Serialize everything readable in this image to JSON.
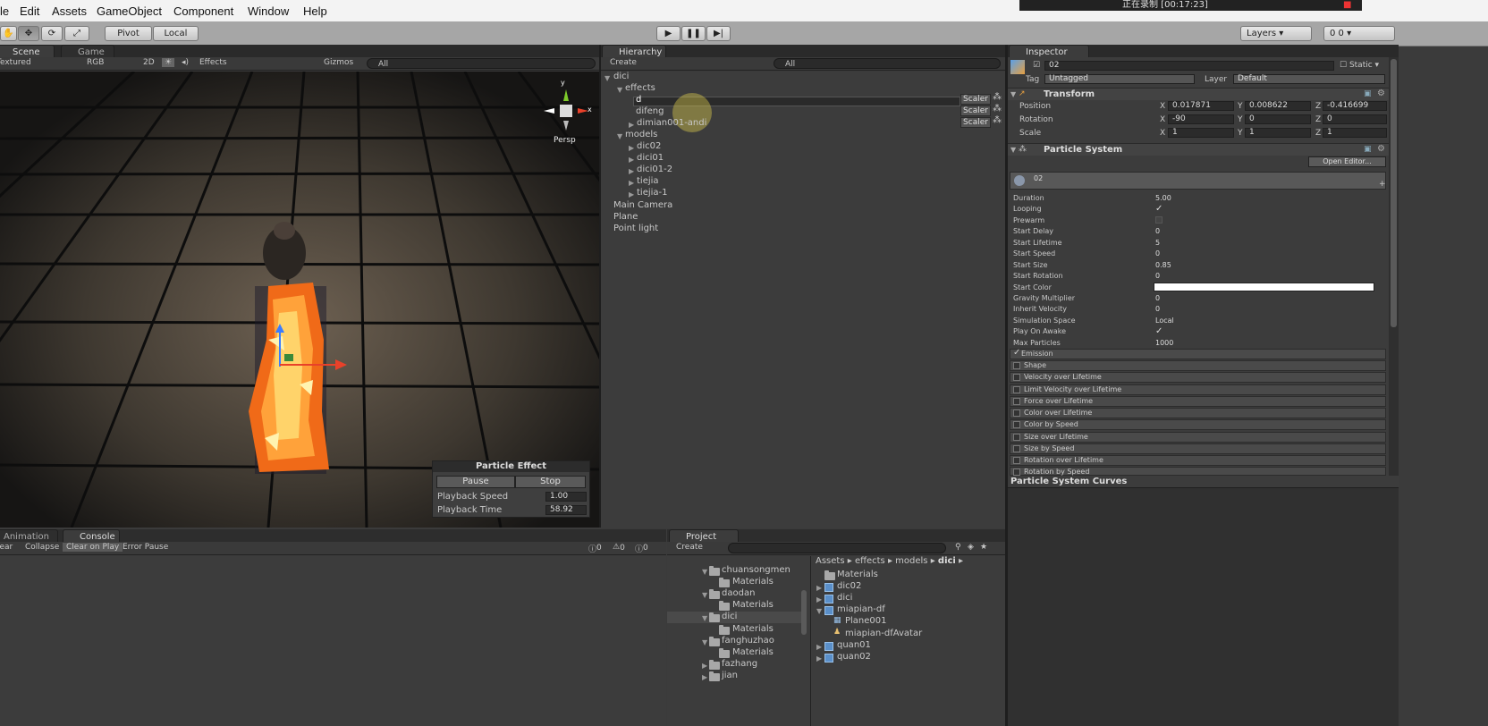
{
  "menu": [
    "le",
    "Edit",
    "Assets",
    "GameObject",
    "Component",
    "Window",
    "Help"
  ],
  "recorder": {
    "status": "正在录制 [00:17:23]"
  },
  "toolbar": {
    "pivot": "Pivot",
    "local": "Local",
    "layers": "Layers",
    "layout": "0 0"
  },
  "scene_view": {
    "tabs": [
      "Scene",
      "Game"
    ],
    "options": [
      "Textured",
      "RGB",
      "2D",
      "Effects",
      "Gizmos"
    ],
    "search_placeholder": "All",
    "gizmo": {
      "y": "y",
      "x": "x",
      "persp": "Persp"
    }
  },
  "particle_effect": {
    "title": "Particle Effect",
    "pause": "Pause",
    "stop": "Stop",
    "playback_speed_label": "Playback Speed",
    "playback_speed": "1.00",
    "playback_time_label": "Playback Time",
    "playback_time": "58.92"
  },
  "hierarchy": {
    "tab": "Hierarchy",
    "create": "Create",
    "search_placeholder": "All",
    "items": [
      "dici",
      "effects",
      "d",
      "difeng",
      "dimian001-andi",
      "models",
      "dic02",
      "dici01",
      "dici01-2",
      "tiejia",
      "tiejia-1",
      "Main Camera",
      "Plane",
      "Point light"
    ],
    "scaler": "Scaler"
  },
  "inspector": {
    "tab": "Inspector",
    "object_name": "02",
    "static": "Static",
    "tag_label": "Tag",
    "tag": "Untagged",
    "layer_label": "Layer",
    "layer": "Default",
    "transform": {
      "title": "Transform",
      "position_label": "Position",
      "position": {
        "x": "0.017871",
        "y": "0.008622",
        "z": "-0.416699"
      },
      "rotation_label": "Rotation",
      "rotation": {
        "x": "-90",
        "y": "0",
        "z": "0"
      },
      "scale_label": "Scale",
      "scale": {
        "x": "1",
        "y": "1",
        "z": "1"
      }
    },
    "particle_system": {
      "title": "Particle System",
      "open_editor": "Open Editor...",
      "system_name": "02",
      "properties": [
        {
          "label": "Duration",
          "value": "5.00"
        },
        {
          "label": "Looping",
          "value": "✓"
        },
        {
          "label": "Prewarm",
          "value": ""
        },
        {
          "label": "Start Delay",
          "value": "0"
        },
        {
          "label": "Start Lifetime",
          "value": "5"
        },
        {
          "label": "Start Speed",
          "value": "0"
        },
        {
          "label": "Start Size",
          "value": "0.85"
        },
        {
          "label": "Start Rotation",
          "value": "0"
        },
        {
          "label": "Start Color",
          "value": ""
        },
        {
          "label": "Gravity Multiplier",
          "value": "0"
        },
        {
          "label": "Inherit Velocity",
          "value": "0"
        },
        {
          "label": "Simulation Space",
          "value": "Local"
        },
        {
          "label": "Play On Awake",
          "value": "✓"
        },
        {
          "label": "Max Particles",
          "value": "1000"
        }
      ],
      "modules": [
        "Emission",
        "Shape",
        "Velocity over Lifetime",
        "Limit Velocity over Lifetime",
        "Force over Lifetime",
        "Color over Lifetime",
        "Color by Speed",
        "Size over Lifetime",
        "Size by Speed",
        "Rotation over Lifetime",
        "Rotation by Speed"
      ],
      "emission_enabled": true
    },
    "curves_title": "Particle System Curves"
  },
  "console": {
    "tabs": [
      "Animation",
      "Console"
    ],
    "buttons": [
      "lear",
      "Collapse",
      "Clear on Play",
      "Error Pause"
    ],
    "counts": [
      "0",
      "0",
      "0"
    ]
  },
  "project": {
    "tab": "Project",
    "create": "Create",
    "breadcrumb": [
      "Assets",
      "effects",
      "models",
      "dici"
    ],
    "folders": [
      "chuansongmen",
      "Materials",
      "daodan",
      "Materials",
      "dici",
      "Materials",
      "fanghuzhao",
      "Materials",
      "fazhang",
      "jian"
    ],
    "assets": [
      "Materials",
      "dic02",
      "dici",
      "miapian-df",
      "Plane001",
      "miapian-dfAvatar",
      "quan01",
      "quan02"
    ]
  }
}
